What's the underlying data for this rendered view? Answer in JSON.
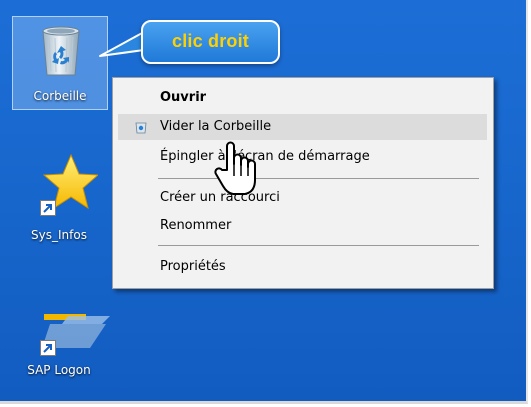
{
  "desktop": {
    "icons": [
      {
        "label": "Corbeille",
        "icon": "recycle-bin-icon",
        "selected": true
      },
      {
        "label": "Sys_Infos",
        "icon": "star-shortcut-icon",
        "selected": false
      },
      {
        "label": "SAP Logon",
        "icon": "sap-logon-icon",
        "selected": false
      }
    ]
  },
  "callout": {
    "text": "clic droit"
  },
  "context_menu": {
    "items": [
      {
        "label": "Ouvrir",
        "bold": true
      },
      {
        "label": "Vider la Corbeille",
        "icon": "recycle-bin-small-icon",
        "highlighted": true
      },
      {
        "label": "Épingler à l'écran de démarrage"
      },
      {
        "label": "Créer un raccourci"
      },
      {
        "label": "Renommer"
      },
      {
        "label": "Propriétés"
      }
    ]
  },
  "colors": {
    "desktop": "#1766cc",
    "callout_text": "#ffd100",
    "menu_bg": "#f2f2f2"
  }
}
